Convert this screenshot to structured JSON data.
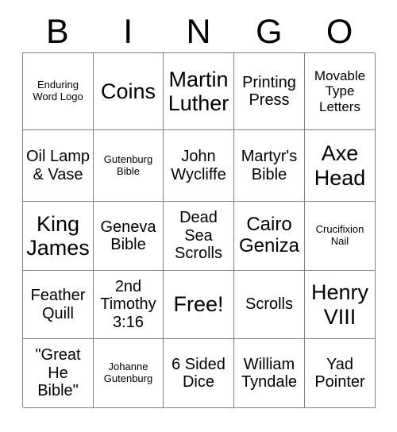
{
  "header": {
    "letters": [
      "B",
      "I",
      "N",
      "G",
      "O"
    ]
  },
  "grid": {
    "rows": 5,
    "columns": 5,
    "free_space_label": "Free!",
    "cells": [
      [
        {
          "label": "Enduring Word Logo",
          "size": "xs"
        },
        {
          "label": "Coins",
          "size": "xl"
        },
        {
          "label": "Martin Luther",
          "size": "xl"
        },
        {
          "label": "Printing Press",
          "size": "md"
        },
        {
          "label": "Movable Type Letters",
          "size": "sm"
        }
      ],
      [
        {
          "label": "Oil Lamp & Vase",
          "size": "md"
        },
        {
          "label": "Gutenburg Bible",
          "size": "xs"
        },
        {
          "label": "John Wycliffe",
          "size": "md"
        },
        {
          "label": "Martyr's Bible",
          "size": "md"
        },
        {
          "label": "Axe Head",
          "size": "xl"
        }
      ],
      [
        {
          "label": "King James",
          "size": "xl"
        },
        {
          "label": "Geneva Bible",
          "size": "md"
        },
        {
          "label": "Dead Sea Scrolls",
          "size": "md"
        },
        {
          "label": "Cairo Geniza",
          "size": "lg"
        },
        {
          "label": "Crucifixion Nail",
          "size": "xs"
        }
      ],
      [
        {
          "label": "Feather Quill",
          "size": "md"
        },
        {
          "label": "2nd Timothy 3:16",
          "size": "md"
        },
        {
          "label": "Free!",
          "size": "xl"
        },
        {
          "label": "Scrolls",
          "size": "md"
        },
        {
          "label": "Henry VIII",
          "size": "xl"
        }
      ],
      [
        {
          "label": "\"Great He Bible\"",
          "size": "md"
        },
        {
          "label": "Johanne Gutenburg",
          "size": "xs"
        },
        {
          "label": "6 Sided Dice",
          "size": "md"
        },
        {
          "label": "William Tyndale",
          "size": "md"
        },
        {
          "label": "Yad Pointer",
          "size": "md"
        }
      ]
    ]
  },
  "colors": {
    "background": "#ffffff",
    "text": "#000000",
    "grid_line": "#808080"
  }
}
